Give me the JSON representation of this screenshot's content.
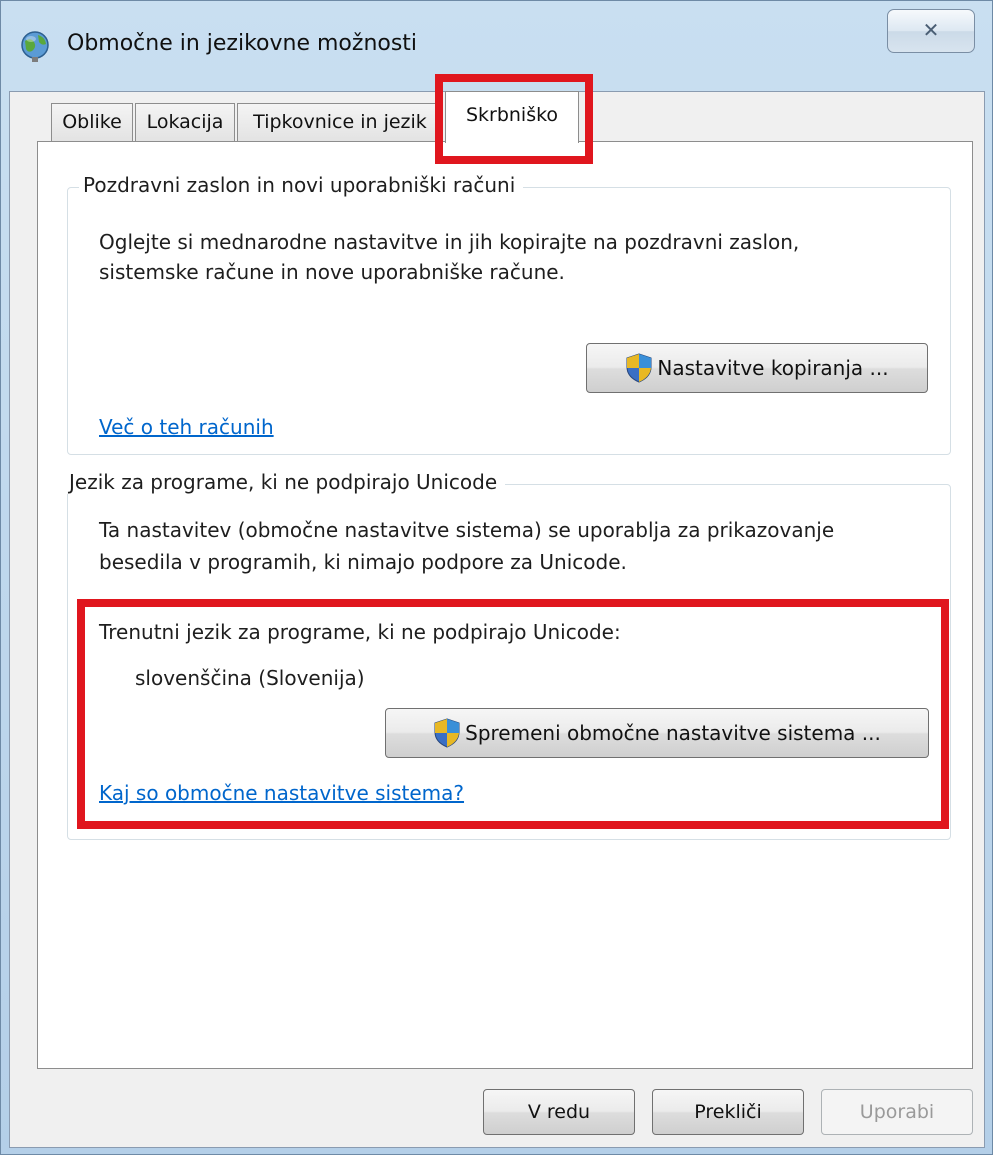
{
  "window": {
    "title": "Območne in jezikovne možnosti",
    "close_glyph": "✕"
  },
  "tabs": [
    {
      "label": "Oblike",
      "active": false
    },
    {
      "label": "Lokacija",
      "active": false
    },
    {
      "label": "Tipkovnice in jezik",
      "active": false
    },
    {
      "label": "Skrbniško",
      "active": true
    }
  ],
  "welcome_group": {
    "title": "Pozdravni zaslon in novi uporabniški računi",
    "description_line1": "Oglejte si mednarodne nastavitve in jih kopirajte na pozdravni zaslon,",
    "description_line2": "sistemske račune in nove uporabniške račune.",
    "copy_button": "Nastavitve kopiranja ...",
    "link": "Več o teh računih"
  },
  "unicode_group": {
    "title": "Jezik za programe, ki ne podpirajo Unicode",
    "description_line1": "Ta nastavitev (območne nastavitve sistema) se uporablja za prikazovanje",
    "description_line2": "besedila v programih, ki nimajo podpore za Unicode.",
    "current_label": "Trenutni jezik za programe, ki ne podpirajo Unicode:",
    "current_value": "slovenščina (Slovenija)",
    "change_button": "Spremeni območne nastavitve sistema ...",
    "link": "Kaj so območne nastavitve sistema?"
  },
  "footer": {
    "ok": "V redu",
    "cancel": "Prekliči",
    "apply": "Uporabi"
  },
  "icons": {
    "window": "globe-icon",
    "uac": "uac-shield-icon"
  },
  "colors": {
    "highlight_box": "#e0161e",
    "link": "#0066cc"
  }
}
